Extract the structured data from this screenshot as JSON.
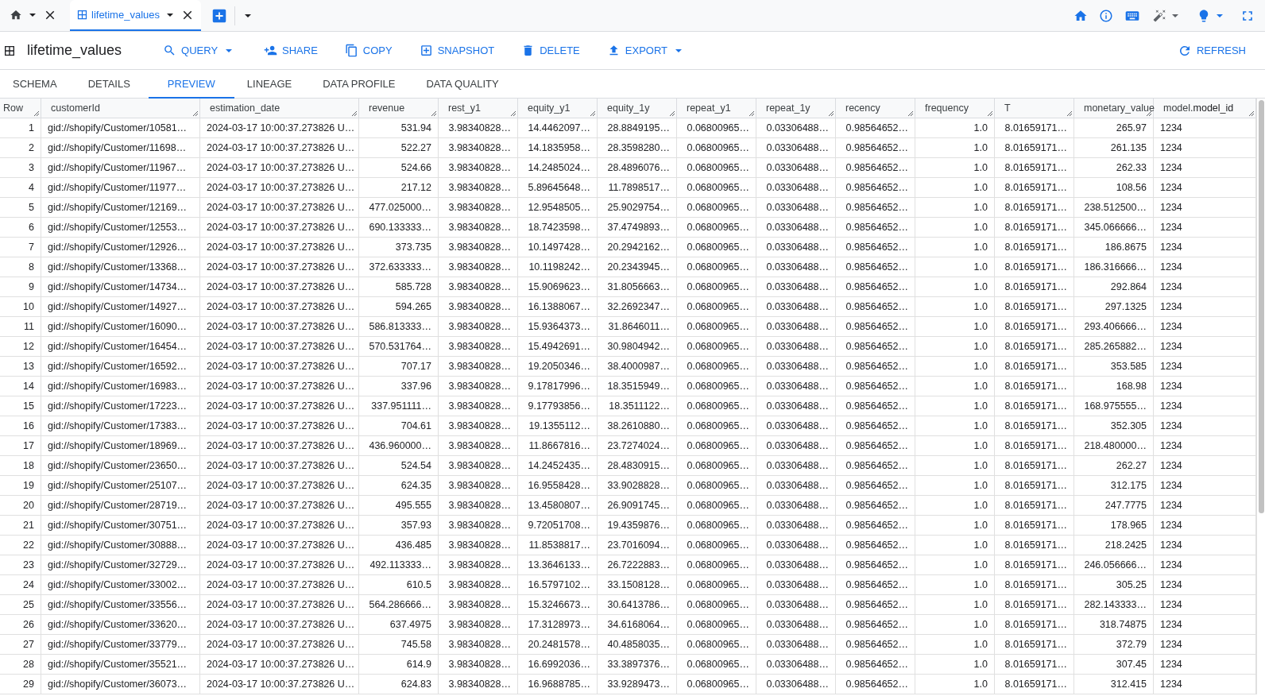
{
  "top_tabs": [
    {
      "kind": "home",
      "selected": false
    },
    {
      "kind": "table",
      "label": "lifetime_values",
      "selected": true
    }
  ],
  "header": {
    "title": "lifetime_values",
    "actions": [
      {
        "label": "QUERY",
        "dropdown": true
      },
      {
        "label": "SHARE",
        "dropdown": false
      },
      {
        "label": "COPY",
        "dropdown": false
      },
      {
        "label": "SNAPSHOT",
        "dropdown": false
      },
      {
        "label": "DELETE",
        "dropdown": false
      },
      {
        "label": "EXPORT",
        "dropdown": true
      }
    ],
    "refresh": "REFRESH"
  },
  "sub_tabs": [
    {
      "label": "SCHEMA",
      "selected": false
    },
    {
      "label": "DETAILS",
      "selected": false
    },
    {
      "label": "PREVIEW",
      "selected": true
    },
    {
      "label": "LINEAGE",
      "selected": false
    },
    {
      "label": "DATA PROFILE",
      "selected": false
    },
    {
      "label": "DATA QUALITY",
      "selected": false
    }
  ],
  "table": {
    "columns": [
      {
        "label": "Row",
        "kind": "number"
      },
      {
        "label": "customerId",
        "kind": "text"
      },
      {
        "label": "estimation_date",
        "kind": "text"
      },
      {
        "label": "revenue",
        "kind": "number"
      },
      {
        "label": "rest_y1",
        "kind": "number"
      },
      {
        "label": "equity_y1",
        "kind": "number"
      },
      {
        "label": "equity_1y",
        "kind": "number"
      },
      {
        "label": "repeat_y1",
        "kind": "number"
      },
      {
        "label": "repeat_1y",
        "kind": "number"
      },
      {
        "label": "recency",
        "kind": "number"
      },
      {
        "label": "frequency",
        "kind": "number"
      },
      {
        "label": "T",
        "kind": "number"
      },
      {
        "label": "monetary_value",
        "kind": "number"
      },
      {
        "label": "model.**model_id**",
        "kind": "text"
      }
    ],
    "rows": [
      [
        "1",
        "gid://shopify/Customer/10581…",
        "2024-03-17 10:00:37.273826 U…",
        "531.94",
        "3.98340828…",
        "14.4462097…",
        "28.8849195…",
        "0.06800965…",
        "0.03306488…",
        "0.98564652…",
        "1.0",
        "8.01659171…",
        "265.97",
        "1234"
      ],
      [
        "2",
        "gid://shopify/Customer/11698…",
        "2024-03-17 10:00:37.273826 U…",
        "522.27",
        "3.98340828…",
        "14.1835958…",
        "28.3598280…",
        "0.06800965…",
        "0.03306488…",
        "0.98564652…",
        "1.0",
        "8.01659171…",
        "261.135",
        "1234"
      ],
      [
        "3",
        "gid://shopify/Customer/11967…",
        "2024-03-17 10:00:37.273826 U…",
        "524.66",
        "3.98340828…",
        "14.2485024…",
        "28.4896076…",
        "0.06800965…",
        "0.03306488…",
        "0.98564652…",
        "1.0",
        "8.01659171…",
        "262.33",
        "1234"
      ],
      [
        "4",
        "gid://shopify/Customer/11977…",
        "2024-03-17 10:00:37.273826 U…",
        "217.12",
        "3.98340828…",
        "5.89645648…",
        "11.7898517…",
        "0.06800965…",
        "0.03306488…",
        "0.98564652…",
        "1.0",
        "8.01659171…",
        "108.56",
        "1234"
      ],
      [
        "5",
        "gid://shopify/Customer/12169…",
        "2024-03-17 10:00:37.273826 U…",
        "477.025000…",
        "3.98340828…",
        "12.9548505…",
        "25.9029754…",
        "0.06800965…",
        "0.03306488…",
        "0.98564652…",
        "1.0",
        "8.01659171…",
        "238.512500…",
        "1234"
      ],
      [
        "6",
        "gid://shopify/Customer/12553…",
        "2024-03-17 10:00:37.273826 U…",
        "690.133333…",
        "3.98340828…",
        "18.7423598…",
        "37.4749893…",
        "0.06800965…",
        "0.03306488…",
        "0.98564652…",
        "1.0",
        "8.01659171…",
        "345.066666…",
        "1234"
      ],
      [
        "7",
        "gid://shopify/Customer/12926…",
        "2024-03-17 10:00:37.273826 U…",
        "373.735",
        "3.98340828…",
        "10.1497428…",
        "20.2942162…",
        "0.06800965…",
        "0.03306488…",
        "0.98564652…",
        "1.0",
        "8.01659171…",
        "186.8675",
        "1234"
      ],
      [
        "8",
        "gid://shopify/Customer/13368…",
        "2024-03-17 10:00:37.273826 U…",
        "372.633333…",
        "3.98340828…",
        "10.1198242…",
        "20.2343945…",
        "0.06800965…",
        "0.03306488…",
        "0.98564652…",
        "1.0",
        "8.01659171…",
        "186.316666…",
        "1234"
      ],
      [
        "9",
        "gid://shopify/Customer/14734…",
        "2024-03-17 10:00:37.273826 U…",
        "585.728",
        "3.98340828…",
        "15.9069623…",
        "31.8056663…",
        "0.06800965…",
        "0.03306488…",
        "0.98564652…",
        "1.0",
        "8.01659171…",
        "292.864",
        "1234"
      ],
      [
        "10",
        "gid://shopify/Customer/14927…",
        "2024-03-17 10:00:37.273826 U…",
        "594.265",
        "3.98340828…",
        "16.1388067…",
        "32.2692347…",
        "0.06800965…",
        "0.03306488…",
        "0.98564652…",
        "1.0",
        "8.01659171…",
        "297.1325",
        "1234"
      ],
      [
        "11",
        "gid://shopify/Customer/16090…",
        "2024-03-17 10:00:37.273826 U…",
        "586.813333…",
        "3.98340828…",
        "15.9364373…",
        "31.8646011…",
        "0.06800965…",
        "0.03306488…",
        "0.98564652…",
        "1.0",
        "8.01659171…",
        "293.406666…",
        "1234"
      ],
      [
        "12",
        "gid://shopify/Customer/16454…",
        "2024-03-17 10:00:37.273826 U…",
        "570.531764…",
        "3.98340828…",
        "15.4942691…",
        "30.9804942…",
        "0.06800965…",
        "0.03306488…",
        "0.98564652…",
        "1.0",
        "8.01659171…",
        "285.265882…",
        "1234"
      ],
      [
        "13",
        "gid://shopify/Customer/16592…",
        "2024-03-17 10:00:37.273826 U…",
        "707.17",
        "3.98340828…",
        "19.2050346…",
        "38.4000987…",
        "0.06800965…",
        "0.03306488…",
        "0.98564652…",
        "1.0",
        "8.01659171…",
        "353.585",
        "1234"
      ],
      [
        "14",
        "gid://shopify/Customer/16983…",
        "2024-03-17 10:00:37.273826 U…",
        "337.96",
        "3.98340828…",
        "9.17817996…",
        "18.3515949…",
        "0.06800965…",
        "0.03306488…",
        "0.98564652…",
        "1.0",
        "8.01659171…",
        "168.98",
        "1234"
      ],
      [
        "15",
        "gid://shopify/Customer/17223…",
        "2024-03-17 10:00:37.273826 U…",
        "337.951111…",
        "3.98340828…",
        "9.17793856…",
        "18.3511122…",
        "0.06800965…",
        "0.03306488…",
        "0.98564652…",
        "1.0",
        "8.01659171…",
        "168.975555…",
        "1234"
      ],
      [
        "16",
        "gid://shopify/Customer/17383…",
        "2024-03-17 10:00:37.273826 U…",
        "704.61",
        "3.98340828…",
        "19.1355112…",
        "38.2610880…",
        "0.06800965…",
        "0.03306488…",
        "0.98564652…",
        "1.0",
        "8.01659171…",
        "352.305",
        "1234"
      ],
      [
        "17",
        "gid://shopify/Customer/18969…",
        "2024-03-17 10:00:37.273826 U…",
        "436.960000…",
        "3.98340828…",
        "11.8667816…",
        "23.7274024…",
        "0.06800965…",
        "0.03306488…",
        "0.98564652…",
        "1.0",
        "8.01659171…",
        "218.480000…",
        "1234"
      ],
      [
        "18",
        "gid://shopify/Customer/23650…",
        "2024-03-17 10:00:37.273826 U…",
        "524.54",
        "3.98340828…",
        "14.2452435…",
        "28.4830915…",
        "0.06800965…",
        "0.03306488…",
        "0.98564652…",
        "1.0",
        "8.01659171…",
        "262.27",
        "1234"
      ],
      [
        "19",
        "gid://shopify/Customer/25107…",
        "2024-03-17 10:00:37.273826 U…",
        "624.35",
        "3.98340828…",
        "16.9558428…",
        "33.9028828…",
        "0.06800965…",
        "0.03306488…",
        "0.98564652…",
        "1.0",
        "8.01659171…",
        "312.175",
        "1234"
      ],
      [
        "20",
        "gid://shopify/Customer/28719…",
        "2024-03-17 10:00:37.273826 U…",
        "495.555",
        "3.98340828…",
        "13.4580807…",
        "26.9091745…",
        "0.06800965…",
        "0.03306488…",
        "0.98564652…",
        "1.0",
        "8.01659171…",
        "247.7775",
        "1234"
      ],
      [
        "21",
        "gid://shopify/Customer/30751…",
        "2024-03-17 10:00:37.273826 U…",
        "357.93",
        "3.98340828…",
        "9.72051708…",
        "19.4359876…",
        "0.06800965…",
        "0.03306488…",
        "0.98564652…",
        "1.0",
        "8.01659171…",
        "178.965",
        "1234"
      ],
      [
        "22",
        "gid://shopify/Customer/30888…",
        "2024-03-17 10:00:37.273826 U…",
        "436.485",
        "3.98340828…",
        "11.8538817…",
        "23.7016094…",
        "0.06800965…",
        "0.03306488…",
        "0.98564652…",
        "1.0",
        "8.01659171…",
        "218.2425",
        "1234"
      ],
      [
        "23",
        "gid://shopify/Customer/32729…",
        "2024-03-17 10:00:37.273826 U…",
        "492.113333…",
        "3.98340828…",
        "13.3646133…",
        "26.7222883…",
        "0.06800965…",
        "0.03306488…",
        "0.98564652…",
        "1.0",
        "8.01659171…",
        "246.056666…",
        "1234"
      ],
      [
        "24",
        "gid://shopify/Customer/33002…",
        "2024-03-17 10:00:37.273826 U…",
        "610.5",
        "3.98340828…",
        "16.5797102…",
        "33.1508128…",
        "0.06800965…",
        "0.03306488…",
        "0.98564652…",
        "1.0",
        "8.01659171…",
        "305.25",
        "1234"
      ],
      [
        "25",
        "gid://shopify/Customer/33556…",
        "2024-03-17 10:00:37.273826 U…",
        "564.286666…",
        "3.98340828…",
        "15.3246673…",
        "30.6413786…",
        "0.06800965…",
        "0.03306488…",
        "0.98564652…",
        "1.0",
        "8.01659171…",
        "282.143333…",
        "1234"
      ],
      [
        "26",
        "gid://shopify/Customer/33620…",
        "2024-03-17 10:00:37.273826 U…",
        "637.4975",
        "3.98340828…",
        "17.3128973…",
        "34.6168064…",
        "0.06800965…",
        "0.03306488…",
        "0.98564652…",
        "1.0",
        "8.01659171…",
        "318.74875",
        "1234"
      ],
      [
        "27",
        "gid://shopify/Customer/33779…",
        "2024-03-17 10:00:37.273826 U…",
        "745.58",
        "3.98340828…",
        "20.2481578…",
        "40.4858035…",
        "0.06800965…",
        "0.03306488…",
        "0.98564652…",
        "1.0",
        "8.01659171…",
        "372.79",
        "1234"
      ],
      [
        "28",
        "gid://shopify/Customer/35521…",
        "2024-03-17 10:00:37.273826 U…",
        "614.9",
        "3.98340828…",
        "16.6992036…",
        "33.3897376…",
        "0.06800965…",
        "0.03306488…",
        "0.98564652…",
        "1.0",
        "8.01659171…",
        "307.45",
        "1234"
      ],
      [
        "29",
        "gid://shopify/Customer/36073…",
        "2024-03-17 10:00:37.273826 U…",
        "624.83",
        "3.98340828…",
        "16.9688785…",
        "33.9289473…",
        "0.06800965…",
        "0.03306488…",
        "0.98564652…",
        "1.0",
        "8.01659171…",
        "312.415",
        "1234"
      ]
    ]
  }
}
